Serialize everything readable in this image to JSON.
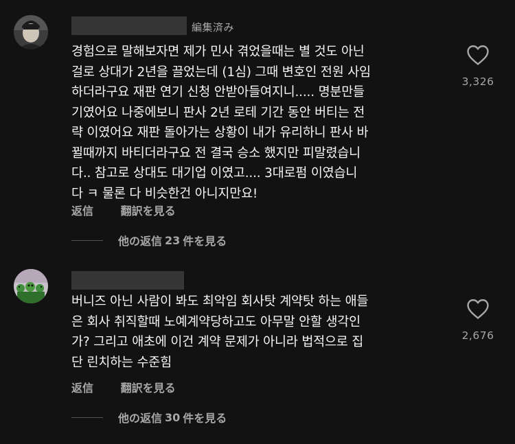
{
  "comments": [
    {
      "edited": "編集済み",
      "lines": [
        "경험으로 말해보자면 제가 민사 겪었을때는 별 것도 아닌",
        "걸로 상대가 2년을 끌었는데 (1심) 그때 변호인 전원 사임",
        "하더라구요 재판 연기 신청 안받아들여지니..... 명분만들",
        "기였어요 나중에보니 판사 2년 로테 기간 동안 버티는 전",
        "략 이였어요 재판 돌아가는 상황이 내가 유리하니 판사 바",
        "뀔때까지 바티더라구요 전 결국 승소 했지만 피말렸습니",
        "다.. 참고로 상대도 대기업 이였고.... 3대로펌 이였습니",
        "다 ㅋ 물론 다 비슷한건 아니지만요!"
      ],
      "like_count": "3,326",
      "reply_label": "返信",
      "translate_label": "翻訳を見る",
      "view_replies_prefix": "他の返信",
      "view_replies_count": "23",
      "view_replies_suffix": "件を見る"
    },
    {
      "lines": [
        "버니즈 아닌 사람이 봐도 최악임 회사탓 계약탓 하는 애들",
        "은 회사 취직할때 노예계약당하고도 아무말 안할 생각인",
        "가? 그리고 애초에 이건 계약 문제가 아니라 법적으로 집",
        "단 린치하는 수준힘"
      ],
      "like_count": "2,676",
      "reply_label": "返信",
      "translate_label": "翻訳を見る",
      "view_replies_prefix": "他の返信",
      "view_replies_count": "30",
      "view_replies_suffix": "件を見る"
    }
  ],
  "icons": {
    "like": "heart-outline-icon"
  },
  "colors": {
    "background": "#121212",
    "primary_text": "#f5f5f5",
    "secondary_text": "#a8a8a8",
    "redaction": "#363636"
  }
}
